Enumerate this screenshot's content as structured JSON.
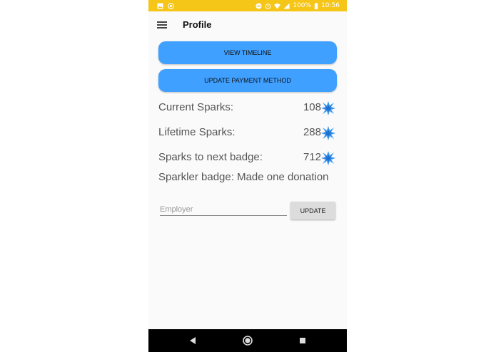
{
  "status_bar": {
    "battery": "100%",
    "time": "10:56",
    "icons": [
      "image-icon",
      "circle-notification-icon",
      "do-not-disturb-icon",
      "alarm-icon",
      "wifi-icon",
      "signal-icon",
      "battery-icon"
    ]
  },
  "app_bar": {
    "title": "Profile",
    "menu_icon": "hamburger-menu-icon"
  },
  "buttons": {
    "view_timeline": "VIEW TIMELINE",
    "update_payment": "UPDATE PAYMENT METHOD",
    "update": "UPDATE"
  },
  "stats": [
    {
      "label": "Current Sparks:",
      "value": "108"
    },
    {
      "label": "Lifetime Sparks:",
      "value": "288"
    },
    {
      "label": "Sparks to next badge:",
      "value": "712"
    }
  ],
  "badge": {
    "text": "Sparkler badge: Made one donation"
  },
  "employer": {
    "placeholder": "Employer",
    "value": ""
  },
  "colors": {
    "status_bar": "#f5c518",
    "primary_button": "#3fa0ff",
    "spark": "#3f9bef"
  },
  "nav_bar": {
    "icons": [
      "back-icon",
      "home-icon",
      "recents-icon"
    ]
  }
}
